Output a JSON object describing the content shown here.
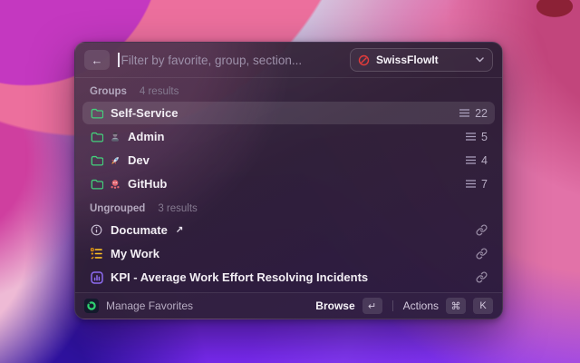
{
  "window": {
    "search": {
      "placeholder": "Filter by favorite, group, section...",
      "back_icon": "back-arrow-icon"
    },
    "scope": {
      "label": "SwissFlowIt",
      "icon": "swissflowit-logo-icon",
      "chevron": "chevron-down-icon"
    },
    "sections": [
      {
        "title": "Groups",
        "results": "4 results",
        "items": [
          {
            "label": "Self-Service",
            "icon": "folder-icon",
            "count": "22",
            "selected": true
          },
          {
            "label": "Admin",
            "icon": "folder-icon",
            "emoji": "technologist-emoji",
            "count": "5"
          },
          {
            "label": "Dev",
            "icon": "folder-icon",
            "emoji": "rocket-emoji",
            "count": "4"
          },
          {
            "label": "GitHub",
            "icon": "folder-icon",
            "emoji": "octopus-emoji",
            "count": "7"
          }
        ]
      },
      {
        "title": "Ungrouped",
        "results": "3 results",
        "items": [
          {
            "label": "Documate",
            "suffix": "↗",
            "icon": "info-icon",
            "trailing_icon": "link-icon"
          },
          {
            "label": "My Work",
            "icon": "task-list-icon",
            "trailing_icon": "link-icon"
          },
          {
            "label": "KPI - Average Work Effort Resolving Incidents",
            "icon": "bar-chart-icon",
            "trailing_icon": "link-icon"
          }
        ]
      }
    ],
    "footer": {
      "app_icon": "app-icon",
      "manage_label": "Manage Favorites",
      "browse_label": "Browse",
      "browse_key": "↵",
      "actions_label": "Actions",
      "actions_keys": [
        "⌘",
        "K"
      ]
    }
  },
  "colors": {
    "folder_green": "#43d17c",
    "scope_red": "#e23b3b",
    "kpi_purple": "#8d6bf0",
    "task_orange": "#f5a623",
    "app_ring_green": "#2fd371",
    "selection": "rgba(255,255,255,0.11)"
  }
}
